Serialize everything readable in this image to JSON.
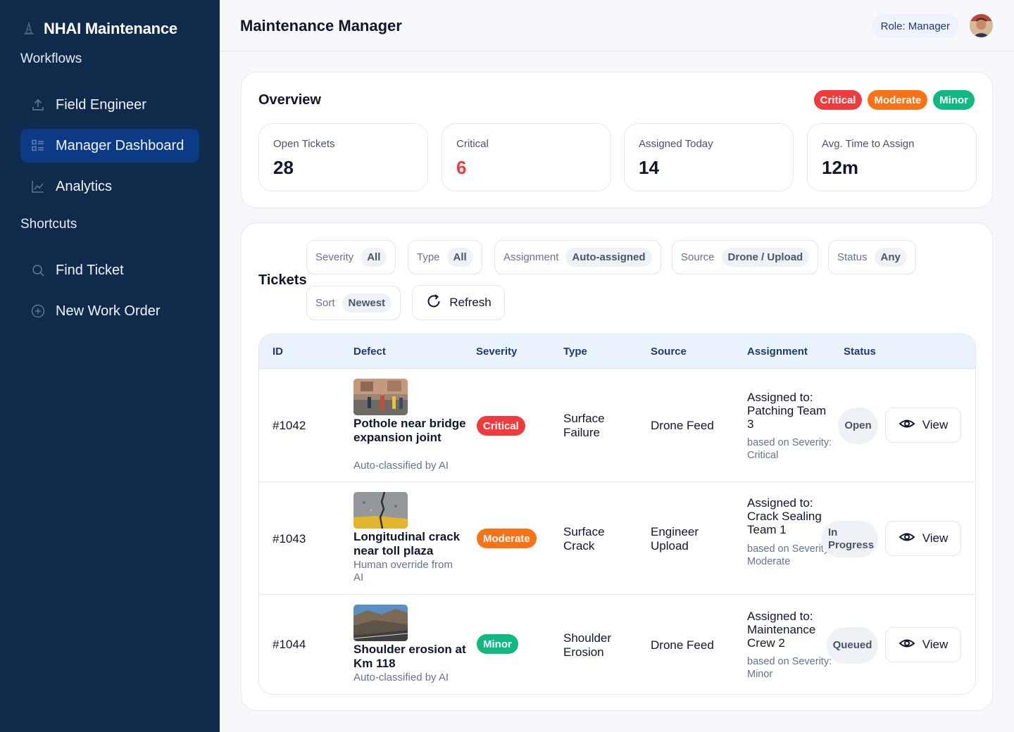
{
  "sidebar": {
    "brand": "NHAI Maintenance",
    "workflows_label": "Workflows",
    "items": [
      {
        "label": "Field Engineer"
      },
      {
        "label": "Manager Dashboard"
      },
      {
        "label": "Analytics"
      }
    ],
    "shortcuts_label": "Shortcuts",
    "shortcuts": [
      {
        "label": "Find Ticket"
      },
      {
        "label": "New Work Order"
      }
    ]
  },
  "header": {
    "title": "Maintenance Manager",
    "role": "Role: Manager"
  },
  "overview": {
    "title": "Overview",
    "legend": [
      "Critical",
      "Moderate",
      "Minor"
    ],
    "stats": [
      {
        "label": "Open Tickets",
        "value": "28"
      },
      {
        "label": "Critical",
        "value": "6"
      },
      {
        "label": "Assigned Today",
        "value": "14"
      },
      {
        "label": "Avg. Time to Assign",
        "value": "12m"
      }
    ]
  },
  "tickets": {
    "title": "Tickets",
    "filters": [
      {
        "key": "Severity",
        "value": "All"
      },
      {
        "key": "Type",
        "value": "All"
      },
      {
        "key": "Assignment",
        "value": "Auto-assigned"
      },
      {
        "key": "Source",
        "value": "Drone / Upload"
      },
      {
        "key": "Status",
        "value": "Any"
      },
      {
        "key": "Sort",
        "value": "Newest"
      }
    ],
    "refresh_label": "Refresh",
    "columns": [
      "ID",
      "Defect",
      "Severity",
      "Type",
      "Source",
      "Assignment",
      "Status"
    ],
    "rows": [
      {
        "id": "#1042",
        "defect": "Pothole near bridge expansion joint",
        "defect_note": "Auto-classified by AI",
        "severity": "Critical",
        "type": "Surface Failure",
        "source": "Drone Feed",
        "assigned": "Assigned to: Patching Team 3",
        "basis": "based on Severity: Critical",
        "status": "Open",
        "action": "View"
      },
      {
        "id": "#1043",
        "defect": "Longitudinal crack near toll plaza",
        "defect_note": "Human override from AI",
        "severity": "Moderate",
        "type": "Surface Crack",
        "source": "Engineer Upload",
        "assigned": "Assigned to: Crack Sealing Team 1",
        "basis": "based on Severity: Moderate",
        "status": "In Progress",
        "action": "View"
      },
      {
        "id": "#1044",
        "defect": "Shoulder erosion at Km 118",
        "defect_note": "Auto-classified by AI",
        "severity": "Minor",
        "type": "Shoulder Erosion",
        "source": "Drone Feed",
        "assigned": "Assigned to: Maintenance Crew 2",
        "basis": "based on Severity: Minor",
        "status": "Queued",
        "action": "View"
      }
    ]
  },
  "colors": {
    "sidebar": "#0f2a4a",
    "active_nav": "#0b3b85",
    "critical": "#ef3b3b",
    "moderate": "#f97316",
    "minor": "#10b981"
  }
}
